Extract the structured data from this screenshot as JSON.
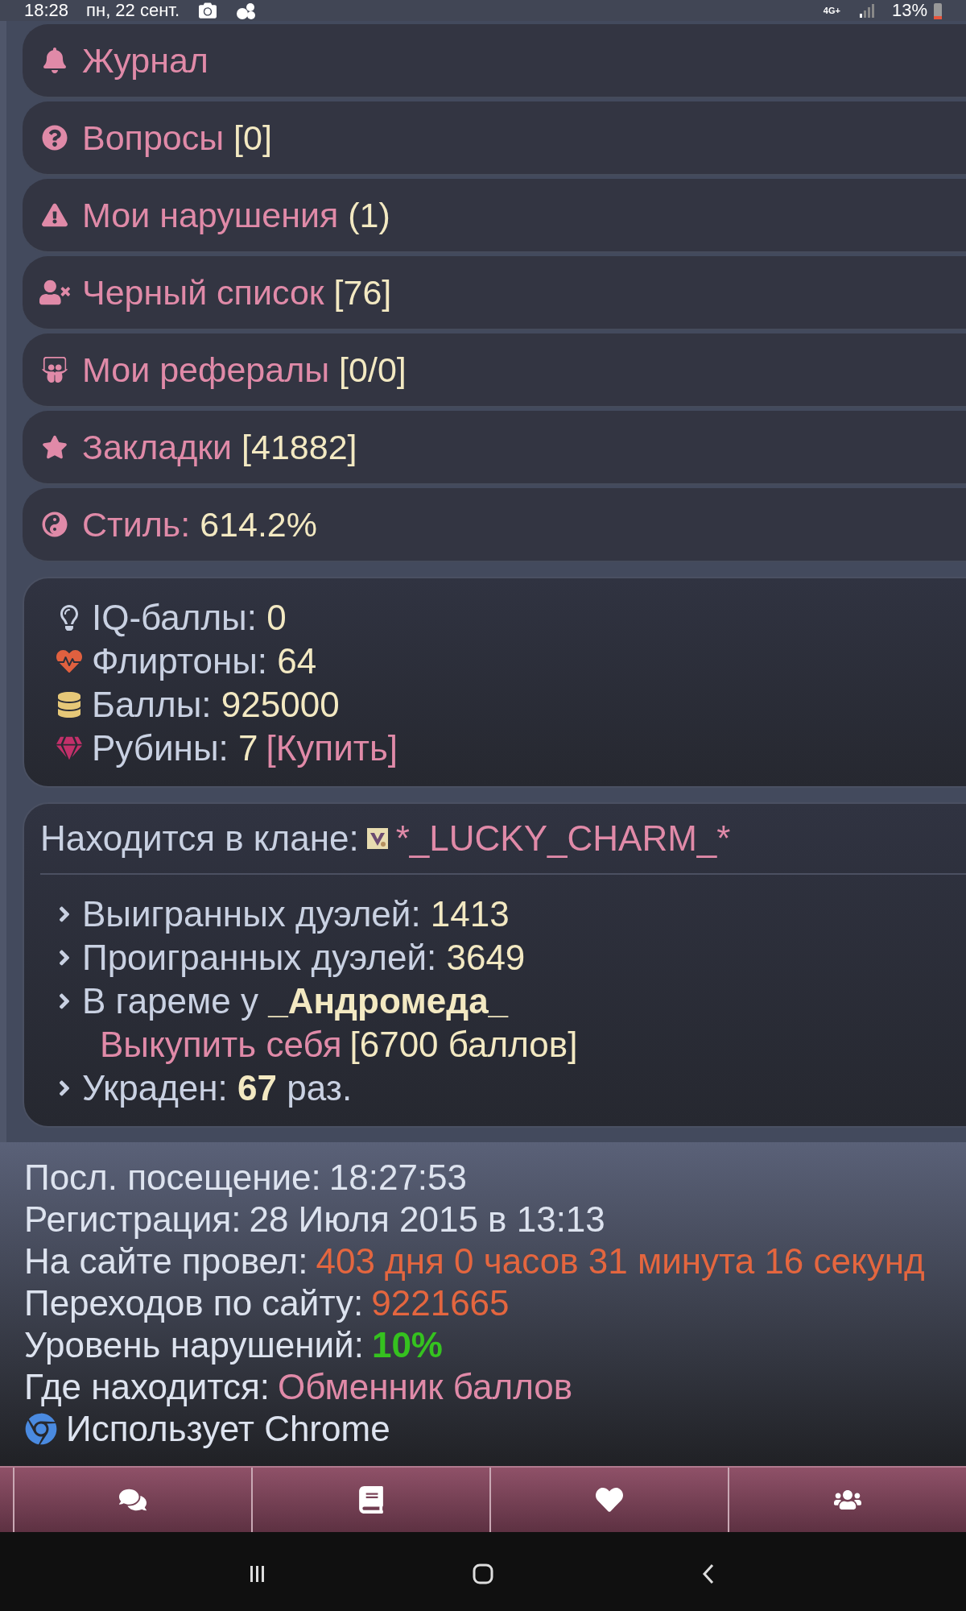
{
  "status_bar": {
    "time": "18:28",
    "date": "пн, 22 сент.",
    "network": "4G+",
    "battery": "13%"
  },
  "menu": [
    {
      "label": "Журнал"
    },
    {
      "label": "Вопросы",
      "count": "[0]"
    },
    {
      "label": "Мои нарушения",
      "count": "(1)"
    },
    {
      "label": "Черный список",
      "count": "[76]"
    },
    {
      "label": "Мои рефералы",
      "count": "[0/0]"
    },
    {
      "label": "Закладки",
      "count": "[41882]"
    },
    {
      "label": "Стиль:",
      "count": "614.2%"
    }
  ],
  "wallet": [
    {
      "label": "IQ-баллы:",
      "value": "0"
    },
    {
      "label": "Флиртоны:",
      "value": "64"
    },
    {
      "label": "Баллы:",
      "value": "925000"
    },
    {
      "label": "Рубины:",
      "value": "7",
      "link": "[Купить]"
    }
  ],
  "clan": {
    "label": "Находится в клане:",
    "name": "*_LUCKY_CHARM_*"
  },
  "facts": [
    {
      "kind": "value",
      "label": "Выигранных дуэлей:",
      "value": "1413"
    },
    {
      "kind": "value",
      "label": "Проигранных дуэлей:",
      "value": "3649"
    },
    {
      "kind": "harem",
      "label": "В гареме у",
      "owner": "_Андромеда_",
      "link": "Выкупить себя",
      "price": "[6700 баллов]"
    },
    {
      "kind": "count",
      "label": "Украден:",
      "value": "67",
      "suffix": "раз."
    }
  ],
  "info": [
    {
      "label": "Посл. посещение:",
      "value": "18:27:53",
      "kind": "plain"
    },
    {
      "label": "Регистрация:",
      "value": "28 Июля 2015 в 13:13",
      "kind": "plain"
    },
    {
      "label": "На сайте провел:",
      "value": "403 дня 0 часов 31 минута 16 секунд",
      "kind": "accent"
    },
    {
      "label": "Переходов по сайту:",
      "value": "9221665",
      "kind": "accent"
    },
    {
      "label": "Уровень нарушений:",
      "value": "10%",
      "kind": "good"
    },
    {
      "label": "Где находится:",
      "value": "Обменник баллов",
      "kind": "link"
    }
  ],
  "browser": "Использует Chrome"
}
